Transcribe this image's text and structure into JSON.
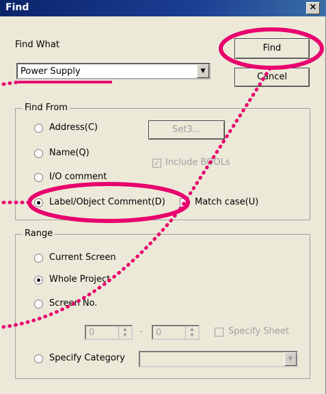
{
  "window": {
    "title": "Find",
    "close_label": "×"
  },
  "find_what": {
    "label": "Find What",
    "value": "Power Supply"
  },
  "buttons": {
    "find": "Find",
    "cancel": "Cancel",
    "set": "Set3..."
  },
  "find_from": {
    "legend": "Find From",
    "options": {
      "address": "Address(C)",
      "name": "Name(Q)",
      "io_comment": "I/O comment",
      "label_object_comment": "Label/Object Comment(D)"
    },
    "selected": "label_object_comment",
    "include_bools": "Include BOOLs",
    "match_case": "Match case(U)"
  },
  "range": {
    "legend": "Range",
    "options": {
      "current_screen": "Current Screen",
      "whole_project": "Whole Project",
      "screen_no": "Screen No.",
      "specify_category": "Specify Category"
    },
    "selected": "whole_project",
    "screen_from": "0",
    "screen_to": "0",
    "dash": "-",
    "specify_sheet": "Specify Sheet"
  },
  "colors": {
    "annotation": "#e8006e",
    "titlebar": "#0a246a",
    "dialog_bg": "#ece9d8"
  }
}
